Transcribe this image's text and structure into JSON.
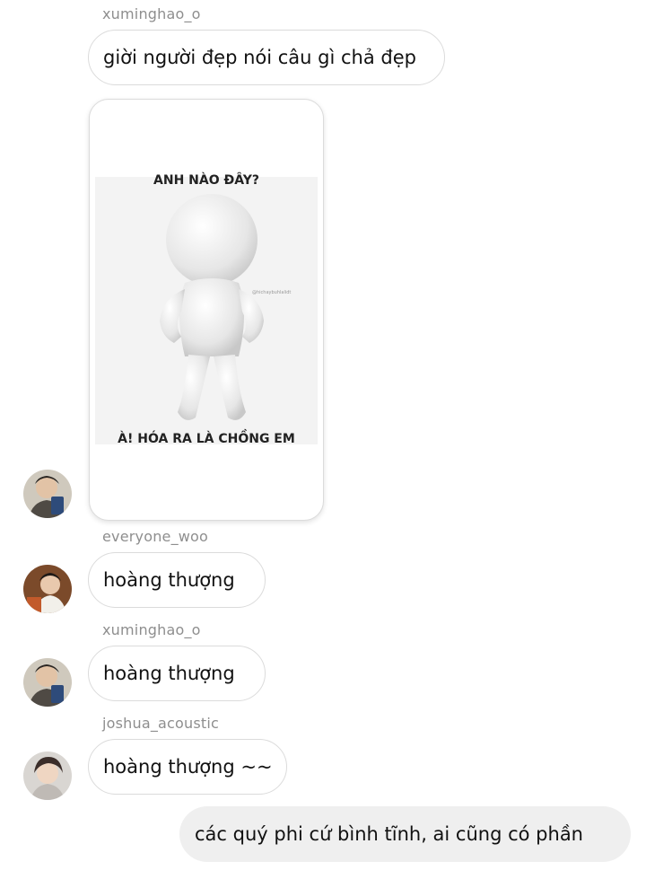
{
  "messages": [
    {
      "type": "username",
      "text": "xuminghao_o"
    },
    {
      "type": "text",
      "text": "giời người đẹp nói câu gì chả đẹp"
    },
    {
      "type": "image",
      "meme": {
        "top_text": "ANH NÀO ĐÂY?",
        "bottom_text": "À! HÓA RA LÀ CHỒNG EM",
        "watermark": "@hichaybuhlalidt"
      }
    },
    {
      "type": "username",
      "text": "everyone_woo"
    },
    {
      "type": "text",
      "text": "hoàng thượng"
    },
    {
      "type": "username",
      "text": "xuminghao_o"
    },
    {
      "type": "text",
      "text": "hoàng thượng"
    },
    {
      "type": "username",
      "text": "joshua_acoustic"
    },
    {
      "type": "text",
      "text": "hoàng thượng ~~"
    },
    {
      "type": "outgoing",
      "text": "các quý phi cứ bình tĩnh,  ai cũng có phần"
    }
  ],
  "colors": {
    "incoming_border": "#dbdbdb",
    "outgoing_bg": "#efefef",
    "username": "#8e8e8e"
  }
}
